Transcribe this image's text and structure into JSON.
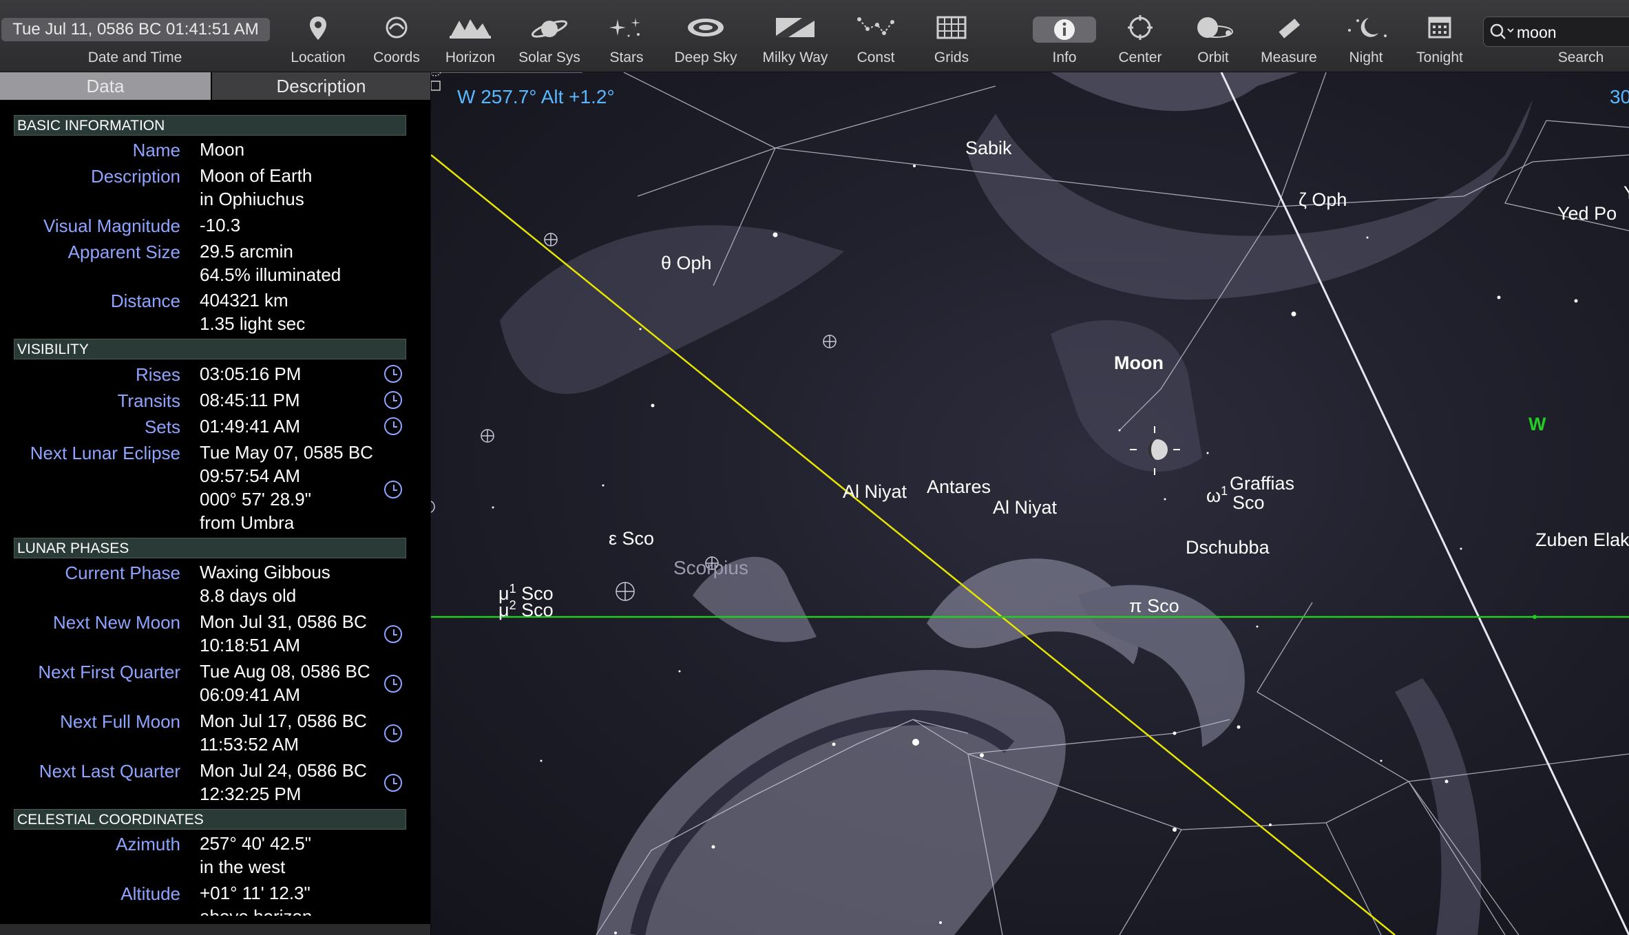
{
  "toolbar": {
    "datetime": "Tue Jul 11, 0586 BC 01:41:51 AM",
    "datetime_label": "Date and Time",
    "buttons": [
      {
        "label": "Location",
        "icon": "location-pin-icon"
      },
      {
        "label": "Coords",
        "icon": "coords-icon"
      },
      {
        "label": "Horizon",
        "icon": "horizon-icon"
      },
      {
        "label": "Solar Sys",
        "icon": "solar-system-icon"
      },
      {
        "label": "Stars",
        "icon": "stars-icon"
      },
      {
        "label": "Deep Sky",
        "icon": "galaxy-icon"
      },
      {
        "label": "Milky Way",
        "icon": "milky-way-icon"
      },
      {
        "label": "Const",
        "icon": "constellation-icon"
      },
      {
        "label": "Grids",
        "icon": "grid-icon"
      },
      {
        "label": "Info",
        "icon": "info-icon"
      },
      {
        "label": "Center",
        "icon": "center-icon"
      },
      {
        "label": "Orbit",
        "icon": "orbit-icon"
      },
      {
        "label": "Measure",
        "icon": "ruler-icon"
      },
      {
        "label": "Night",
        "icon": "night-moon-icon"
      },
      {
        "label": "Tonight",
        "icon": "calendar-icon"
      }
    ],
    "search_value": "moon",
    "search_label": "Search"
  },
  "panel": {
    "tabs": {
      "data": "Data",
      "description": "Description"
    },
    "sections": {
      "basic": "BASIC INFORMATION",
      "visibility": "VISIBILITY",
      "lunar": "LUNAR PHASES",
      "celestial": "CELESTIAL COORDINATES"
    },
    "basic": {
      "name_l": "Name",
      "name_v": "Moon",
      "desc_l": "Description",
      "desc_v1": "Moon of Earth",
      "desc_v2": "in Ophiuchus",
      "mag_l": "Visual Magnitude",
      "mag_v": "-10.3",
      "size_l": "Apparent Size",
      "size_v1": "29.5 arcmin",
      "size_v2": "64.5% illuminated",
      "dist_l": "Distance",
      "dist_v1": "404321 km",
      "dist_v2": "1.35 light sec"
    },
    "visibility": {
      "rises_l": "Rises",
      "rises_v": "03:05:16 PM",
      "transits_l": "Transits",
      "transits_v": "08:45:11 PM",
      "sets_l": "Sets",
      "sets_v": "01:49:41 AM",
      "eclipse_l": "Next Lunar Eclipse",
      "eclipse_v1": "Tue May 07, 0585 BC",
      "eclipse_v2": "09:57:54 AM",
      "eclipse_v3": "000° 57' 28.9\"",
      "eclipse_v4": "from Umbra"
    },
    "lunar": {
      "phase_l": "Current Phase",
      "phase_v1": "Waxing Gibbous",
      "phase_v2": "8.8 days old",
      "new_l": "Next New Moon",
      "new_v1": "Mon Jul 31, 0586 BC",
      "new_v2": "10:18:51 AM",
      "first_l": "Next First Quarter",
      "first_v1": "Tue Aug 08, 0586 BC",
      "first_v2": "06:09:41 AM",
      "full_l": "Next Full Moon",
      "full_v1": "Mon Jul 17, 0586 BC",
      "full_v2": "11:53:52 AM",
      "last_l": "Next Last Quarter",
      "last_v1": "Mon Jul 24, 0586 BC",
      "last_v2": "12:32:25 PM"
    },
    "celestial": {
      "az_l": "Azimuth",
      "az_v1": "257° 40' 42.5\"",
      "az_v2": "in the west",
      "alt_l": "Altitude",
      "alt_v1": "+01° 11' 12.3\"",
      "alt_v2": "above horizon"
    }
  },
  "sky": {
    "cursor_coords": "W 257.7° Alt +1.2°",
    "top_right_partial": "30",
    "labels": {
      "sabik": "Sabik",
      "zeta_oph": "ζ Oph",
      "yed": "Yed Po",
      "y_partial": "Y",
      "theta_oph": "θ Oph",
      "moon": "Moon",
      "west": "W",
      "al_niyat1": "Al Niyat",
      "antares": "Antares",
      "al_niyat2": "Al Niyat",
      "graffias_pre": "ω",
      "graffias_sup": "1",
      "graffias1": "Graffias",
      "graffias2": "Sco",
      "eps_sco": "ε Sco",
      "scorpius": "Scorpius",
      "dschubba": "Dschubba",
      "zuben": "Zuben Elak",
      "mu1_pre": "μ",
      "mu1_sup": "1",
      "mu1": "Sco",
      "mu2_pre": "μ",
      "mu2_sup": "2",
      "mu2": "Sco",
      "pi_sco": "π Sco"
    },
    "colors": {
      "ecliptic": "#e6e600",
      "horizon": "#22cc22",
      "coords": "#5ab8ff",
      "label_blue": "#8ea4ff"
    }
  }
}
